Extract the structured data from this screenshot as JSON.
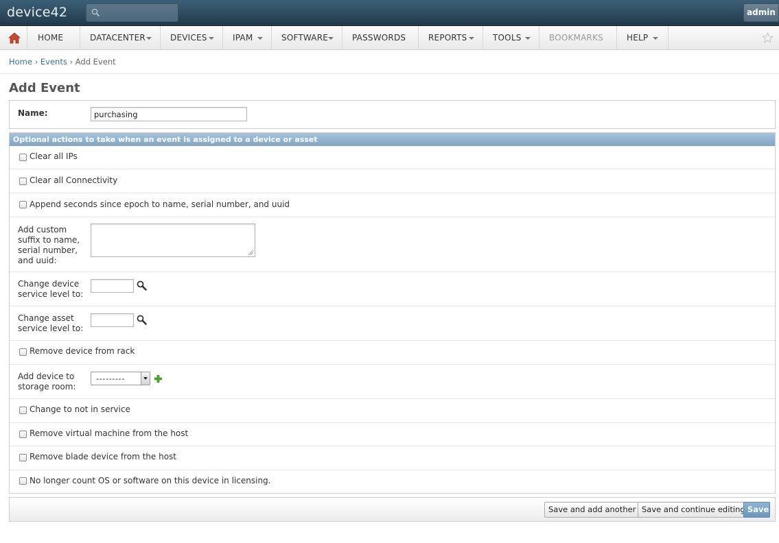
{
  "app": {
    "logo": "device42",
    "user": "admin"
  },
  "nav": {
    "items": [
      {
        "label": "HOME"
      },
      {
        "label": "DATACENTER"
      },
      {
        "label": "DEVICES"
      },
      {
        "label": "IPAM"
      },
      {
        "label": "SOFTWARE"
      },
      {
        "label": "PASSWORDS"
      },
      {
        "label": "REPORTS"
      },
      {
        "label": "TOOLS"
      },
      {
        "label": "BOOKMARKS"
      },
      {
        "label": "HELP"
      }
    ]
  },
  "breadcrumb": {
    "home": "Home",
    "events": "Events",
    "current": "Add Event",
    "separator": "›"
  },
  "page": {
    "title": "Add Event"
  },
  "form": {
    "name_label": "Name:",
    "name_value": "purchasing",
    "section_title": "Optional actions to take when an event is assigned to a device or asset",
    "clear_ips": "Clear all IPs",
    "clear_connectivity": "Clear all Connectivity",
    "append_seconds": "Append seconds since epoch to name, serial number, and uuid",
    "custom_suffix_label": "Add custom suffix to name, serial number, and uuid:",
    "device_service_level_label": "Change device service level to:",
    "asset_service_level_label": "Change asset service level to:",
    "remove_from_rack": "Remove device from rack",
    "storage_room_label": "Add device to storage room:",
    "storage_room_selected": "---------",
    "not_in_service": "Change to not in service",
    "remove_vm": "Remove virtual machine from the host",
    "remove_blade": "Remove blade device from the host",
    "no_licensing": "No longer count OS or software on this device in licensing."
  },
  "buttons": {
    "save_add_another": "Save and add another",
    "save_continue": "Save and continue editing",
    "save": "Save"
  }
}
